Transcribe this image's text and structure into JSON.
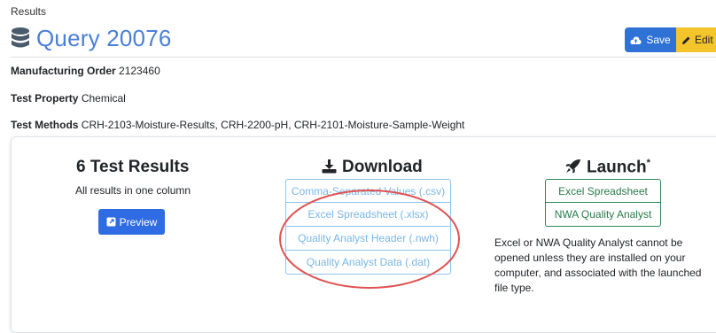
{
  "breadcrumb": "Results",
  "header": {
    "title": "Query 20076",
    "save_label": "Save",
    "edit_label": "Edit",
    "brand_color": "#4a7fd8"
  },
  "meta": [
    {
      "label": "Manufacturing Order",
      "value": "2123460"
    },
    {
      "label": "Test Property",
      "value": "Chemical"
    },
    {
      "label": "Test Methods",
      "value": "CRH-2103-Moisture-Results, CRH-2200-pH, CRH-2101-Moisture-Sample-Weight"
    }
  ],
  "results": {
    "heading": "6 Test Results",
    "subtext": "All results in one column",
    "preview_label": "Preview"
  },
  "download": {
    "heading": "Download",
    "items": [
      "Comma-Separated Values (.csv)",
      "Excel Spreadsheet (.xlsx)",
      "Quality Analyst Header (.nwh)",
      "Quality Analyst Data (.dat)"
    ]
  },
  "launch": {
    "heading": "Launch",
    "asterisk": "*",
    "items": [
      "Excel Spreadsheet",
      "NWA Quality Analyst"
    ],
    "note": "Excel or NWA Quality Analyst cannot be opened unless they are installed on your computer, and associated with the launched file type."
  },
  "icons": {
    "title": "database-icon",
    "save": "cloud-upload-icon",
    "edit": "pencil-icon",
    "preview": "external-link-icon",
    "download": "download-icon",
    "launch": "rocket-icon"
  },
  "colors": {
    "save_button": "#2e72d6",
    "edit_button": "#f4c42b",
    "preview_button": "#2f6be3",
    "download_border": "#8fc3e8",
    "launch_border": "#2e8b57",
    "annotation": "#e05252"
  }
}
